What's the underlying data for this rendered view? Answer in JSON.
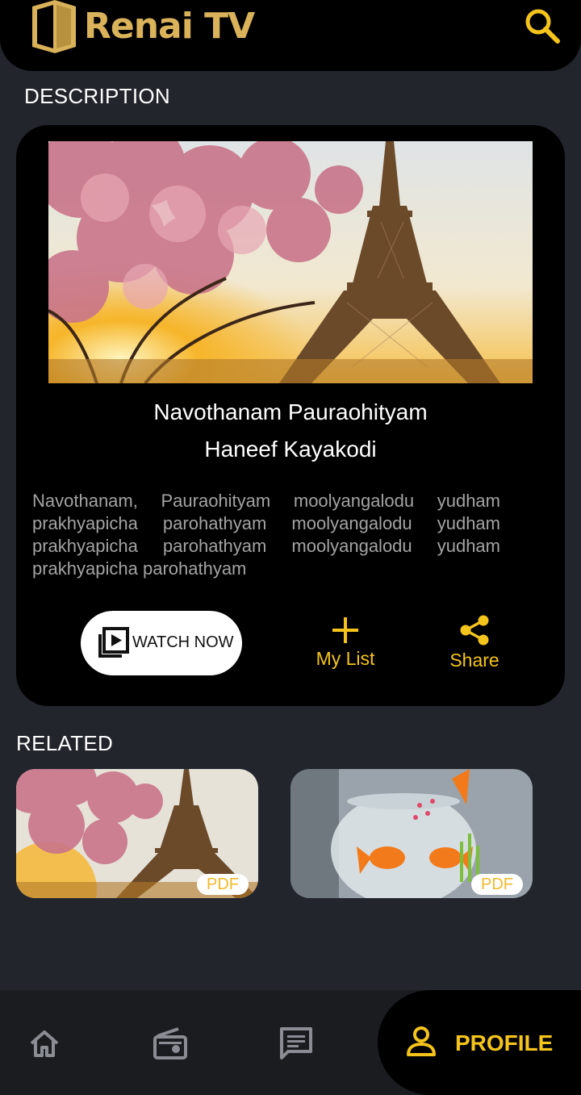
{
  "header": {
    "app_title": "Renai TV",
    "search_icon": "search-icon"
  },
  "description_section": {
    "heading": "DESCRIPTION",
    "title_line1": "Navothanam Pauraohityam",
    "title_line2": "Haneef Kayakodi",
    "body": "Navothanam, Pauraohityam moolyangalodu yudham prakhyapicha parohathyam moolyangalodu yudham prakhyapicha parohathyam moolyangalodu yudham prakhyapicha parohathyam",
    "watch_label": "WATCH NOW",
    "mylist_label": "My List",
    "share_label": "Share"
  },
  "related_section": {
    "heading": "RELATED",
    "items": [
      {
        "badge": "PDF",
        "image": "eiffel-tower"
      },
      {
        "badge": "PDF",
        "image": "goldfish-bowl"
      }
    ]
  },
  "bottom_nav": {
    "items": [
      {
        "icon": "home-icon"
      },
      {
        "icon": "radio-icon"
      },
      {
        "icon": "chat-icon"
      }
    ],
    "active_label": "PROFILE",
    "active_icon": "person-icon"
  },
  "colors": {
    "accent": "#f5c41c",
    "logo_gold": "#d9b25a",
    "background": "#22252c",
    "card": "#000000"
  }
}
